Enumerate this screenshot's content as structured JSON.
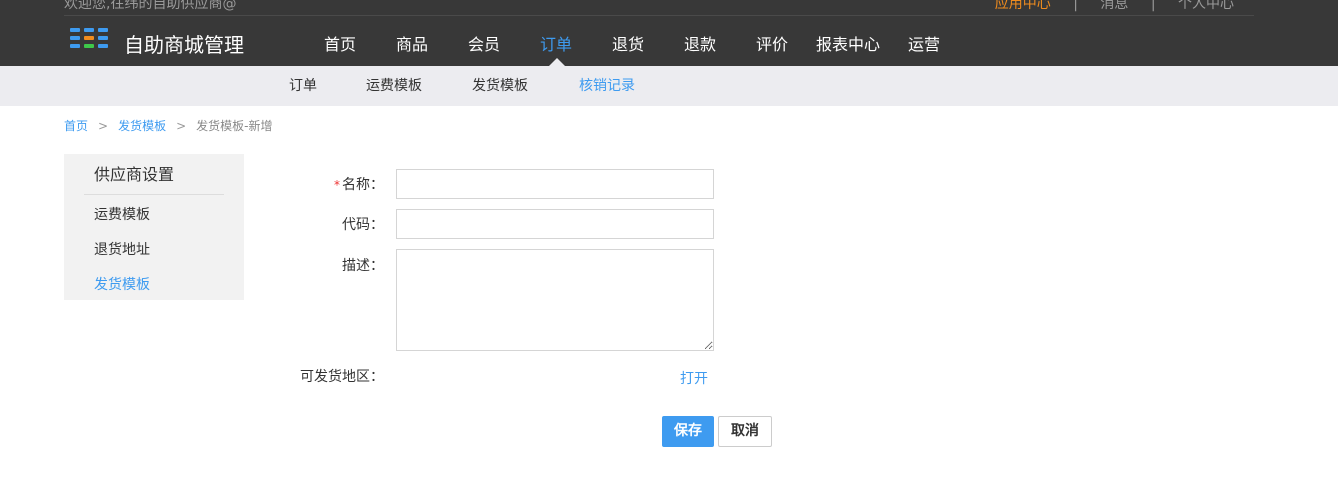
{
  "header": {
    "welcome": "欢迎您,往纬的自助供应商@",
    "links": [
      {
        "label": "应用中心",
        "active": true
      },
      {
        "label": "消息",
        "active": false
      },
      {
        "label": "个人中心",
        "active": false
      }
    ],
    "link_separator": "|",
    "brand": "自助商城管理",
    "logo_colors": [
      "#3e9bf0",
      "#3e9bf0",
      "#3e9bf0",
      "#3e9bf0",
      "#f08c1e",
      "#3e9bf0",
      "#3e9bf0",
      "#3ec84a",
      "#3e9bf0"
    ],
    "nav": [
      {
        "label": "首页",
        "active": false
      },
      {
        "label": "商品",
        "active": false
      },
      {
        "label": "会员",
        "active": false
      },
      {
        "label": "订单",
        "active": true
      },
      {
        "label": "退货",
        "active": false
      },
      {
        "label": "退款",
        "active": false
      },
      {
        "label": "评价",
        "active": false
      },
      {
        "label": "报表中心",
        "active": false
      },
      {
        "label": "运营",
        "active": false
      }
    ]
  },
  "subnav": [
    {
      "label": "订单",
      "active": false
    },
    {
      "label": "运费模板",
      "active": false
    },
    {
      "label": "发货模板",
      "active": false
    },
    {
      "label": "核销记录",
      "active": true
    }
  ],
  "breadcrumb": {
    "items": [
      "首页",
      "发货模板"
    ],
    "separator": ">",
    "current": "发货模板-新增"
  },
  "sidebar": {
    "title": "供应商设置",
    "items": [
      {
        "label": "运费模板",
        "active": false
      },
      {
        "label": "退货地址",
        "active": false
      },
      {
        "label": "发货模板",
        "active": true
      }
    ]
  },
  "form": {
    "name_label": "名称：",
    "name_required_mark": "*",
    "name_value": "",
    "code_label": "代码：",
    "code_value": "",
    "desc_label": "描述：",
    "desc_value": "",
    "region_label": "可发货地区：",
    "region_link": "打开",
    "save": "保存",
    "cancel": "取消"
  },
  "colors": {
    "accent": "#3e9bf0",
    "highlight": "#f08c1e",
    "topbar": "#383838",
    "subbar": "#ececf0"
  }
}
